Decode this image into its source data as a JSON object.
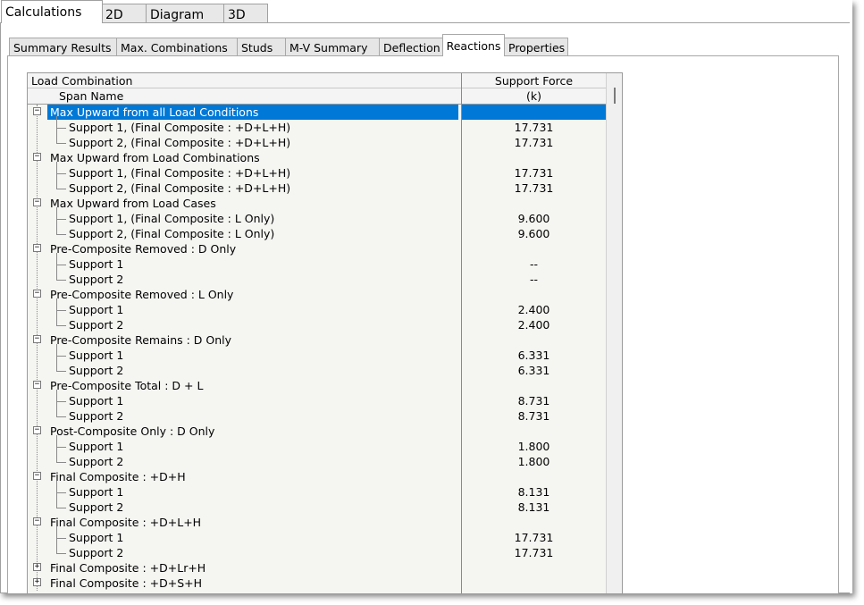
{
  "top_tabs": [
    {
      "label": "Calculations",
      "active": true
    },
    {
      "label": "2D",
      "active": false
    },
    {
      "label": "Diagram",
      "active": false
    },
    {
      "label": "3D",
      "active": false
    }
  ],
  "sub_tabs": [
    {
      "label": "Summary Results"
    },
    {
      "label": "Max. Combinations"
    },
    {
      "label": "Studs"
    },
    {
      "label": "M-V Summary"
    },
    {
      "label": "Deflection"
    },
    {
      "label": "Reactions",
      "active": true
    },
    {
      "label": "Properties"
    }
  ],
  "grid": {
    "header": {
      "col1_line1": "Load Combination",
      "col1_line2": "Span Name",
      "col2_line1": "Support Force",
      "col2_line2": "(k)"
    },
    "rows": [
      {
        "type": "group",
        "expand": "−",
        "label": "Max Upward from all Load Conditions",
        "value": "",
        "selected": true
      },
      {
        "type": "child",
        "label": "Support 1,  (Final Composite :  +D+L+H)",
        "value": "17.731"
      },
      {
        "type": "child",
        "label": "Support 2,  (Final Composite :  +D+L+H)",
        "value": "17.731"
      },
      {
        "type": "group",
        "expand": "−",
        "label": "Max Upward from Load Combinations",
        "value": ""
      },
      {
        "type": "child",
        "label": "Support 1,  (Final Composite :  +D+L+H)",
        "value": "17.731"
      },
      {
        "type": "child",
        "label": "Support 2,  (Final Composite :  +D+L+H)",
        "value": "17.731"
      },
      {
        "type": "group",
        "expand": "−",
        "label": "Max Upward from Load Cases",
        "value": ""
      },
      {
        "type": "child",
        "label": "Support 1,  (Final Composite :  L Only)",
        "value": "9.600"
      },
      {
        "type": "child",
        "label": "Support 2,  (Final Composite :  L Only)",
        "value": "9.600"
      },
      {
        "type": "group",
        "expand": "−",
        "label": "Pre-Composite Removed :  D Only",
        "value": ""
      },
      {
        "type": "child",
        "label": "Support 1",
        "value": "--"
      },
      {
        "type": "child",
        "label": "Support 2",
        "value": "--"
      },
      {
        "type": "group",
        "expand": "−",
        "label": "Pre-Composite Removed :  L Only",
        "value": ""
      },
      {
        "type": "child",
        "label": "Support 1",
        "value": "2.400"
      },
      {
        "type": "child",
        "label": "Support 2",
        "value": "2.400"
      },
      {
        "type": "group",
        "expand": "−",
        "label": "Pre-Composite Remains :  D Only",
        "value": ""
      },
      {
        "type": "child",
        "label": "Support 1",
        "value": "6.331"
      },
      {
        "type": "child",
        "label": "Support 2",
        "value": "6.331"
      },
      {
        "type": "group",
        "expand": "−",
        "label": "Pre-Composite Total :  D + L",
        "value": ""
      },
      {
        "type": "child",
        "label": "Support 1",
        "value": "8.731"
      },
      {
        "type": "child",
        "label": "Support 2",
        "value": "8.731"
      },
      {
        "type": "group",
        "expand": "−",
        "label": "Post-Composite Only :  D Only",
        "value": ""
      },
      {
        "type": "child",
        "label": "Support 1",
        "value": "1.800"
      },
      {
        "type": "child",
        "label": "Support 2",
        "value": "1.800"
      },
      {
        "type": "group",
        "expand": "−",
        "label": "Final Composite :  +D+H",
        "value": ""
      },
      {
        "type": "child",
        "label": "Support 1",
        "value": "8.131"
      },
      {
        "type": "child",
        "label": "Support 2",
        "value": "8.131"
      },
      {
        "type": "group",
        "expand": "−",
        "label": "Final Composite :  +D+L+H",
        "value": ""
      },
      {
        "type": "child",
        "label": "Support 1",
        "value": "17.731"
      },
      {
        "type": "child",
        "label": "Support 2",
        "value": "17.731"
      },
      {
        "type": "group",
        "expand": "+",
        "label": "Final Composite :  +D+Lr+H",
        "value": ""
      },
      {
        "type": "group",
        "expand": "+",
        "label": "Final Composite :  +D+S+H",
        "value": ""
      }
    ]
  }
}
